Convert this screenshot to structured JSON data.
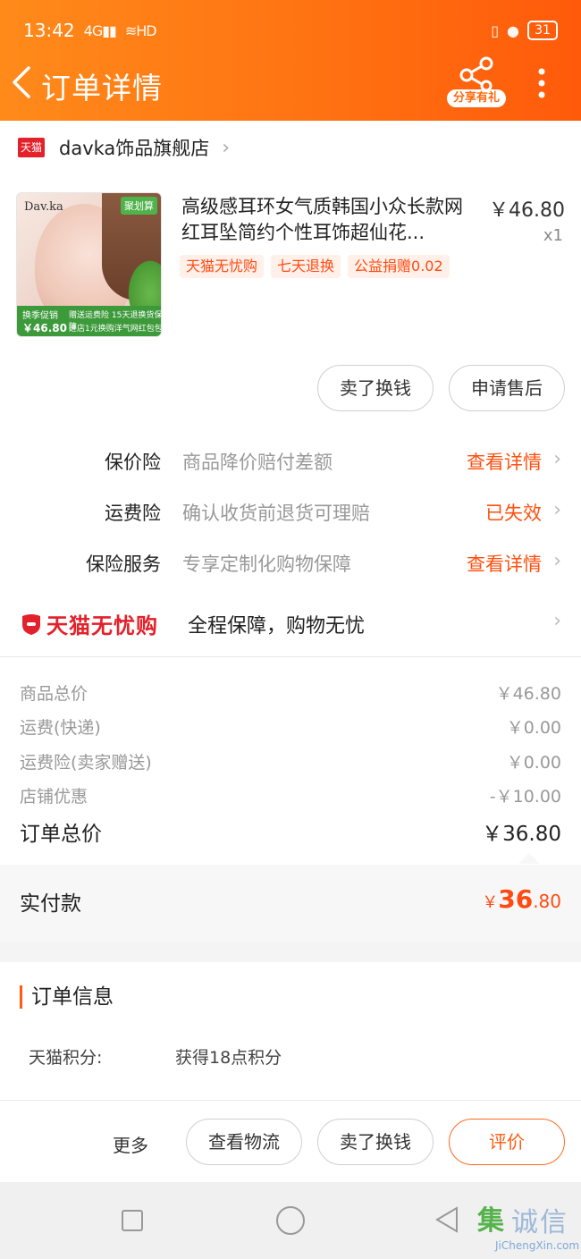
{
  "status_bar": {
    "time": "13:42",
    "signal": "4G",
    "wifi_label": "HD",
    "battery": "31"
  },
  "header": {
    "title": "订单详情",
    "share_label": "分享有礼"
  },
  "shop": {
    "badge": "天猫",
    "name": "davka饰品旗舰店"
  },
  "product": {
    "title": "高级感耳环女气质韩国小众长款网红耳坠简约个性耳饰超仙花...",
    "price": "￥46.80",
    "qty": "x1",
    "tags": [
      "天猫无忧购",
      "七天退换",
      "公益捐赠0.02"
    ],
    "thumb": {
      "brand": "Dav.ka",
      "corner_tag": "聚划算",
      "promo": "换季促销",
      "price": "￥46.80",
      "line1": "赠送运费险 15天退换货保障",
      "line2": "进店1元换购洋气网红包包"
    }
  },
  "product_actions": {
    "sell": "卖了换钱",
    "after_sale": "申请售后"
  },
  "insurance": [
    {
      "label": "保价险",
      "desc": "商品降价赔付差额",
      "action": "查看详情"
    },
    {
      "label": "运费险",
      "desc": "确认收货前退货可理赔",
      "action": "已失效"
    },
    {
      "label": "保险服务",
      "desc": "专享定制化购物保障",
      "action": "查看详情"
    }
  ],
  "wuyou": {
    "brand": "天猫无忧购",
    "text": "全程保障，购物无忧"
  },
  "summary": {
    "rows": [
      {
        "label": "商品总价",
        "value": "￥46.80"
      },
      {
        "label": "运费(快递)",
        "value": "￥0.00"
      },
      {
        "label": "运费险(卖家赠送)",
        "value": "￥0.00"
      },
      {
        "label": "店铺优惠",
        "value": "-￥10.00"
      }
    ],
    "total_label": "订单总价",
    "total_value": "￥36.80"
  },
  "paid": {
    "label": "实付款",
    "currency": "￥",
    "integer": "36",
    "decimal": ".80"
  },
  "order_info": {
    "title": "订单信息",
    "points_key": "天猫积分:",
    "points_value": "获得18点积分"
  },
  "bottom_actions": {
    "more": "更多",
    "logistics": "查看物流",
    "sell": "卖了换钱",
    "review": "评价"
  },
  "watermark": {
    "mark": "集",
    "cn": "诚信",
    "en": "JiChengXin.com"
  },
  "colors": {
    "header_orange": "#ff7212",
    "accent_orange": "#ff5010",
    "tmall_red": "#e4202a"
  },
  "icons": [
    "back-icon",
    "share-icon",
    "more-vertical-icon",
    "chevron-right-icon",
    "shield-icon"
  ]
}
